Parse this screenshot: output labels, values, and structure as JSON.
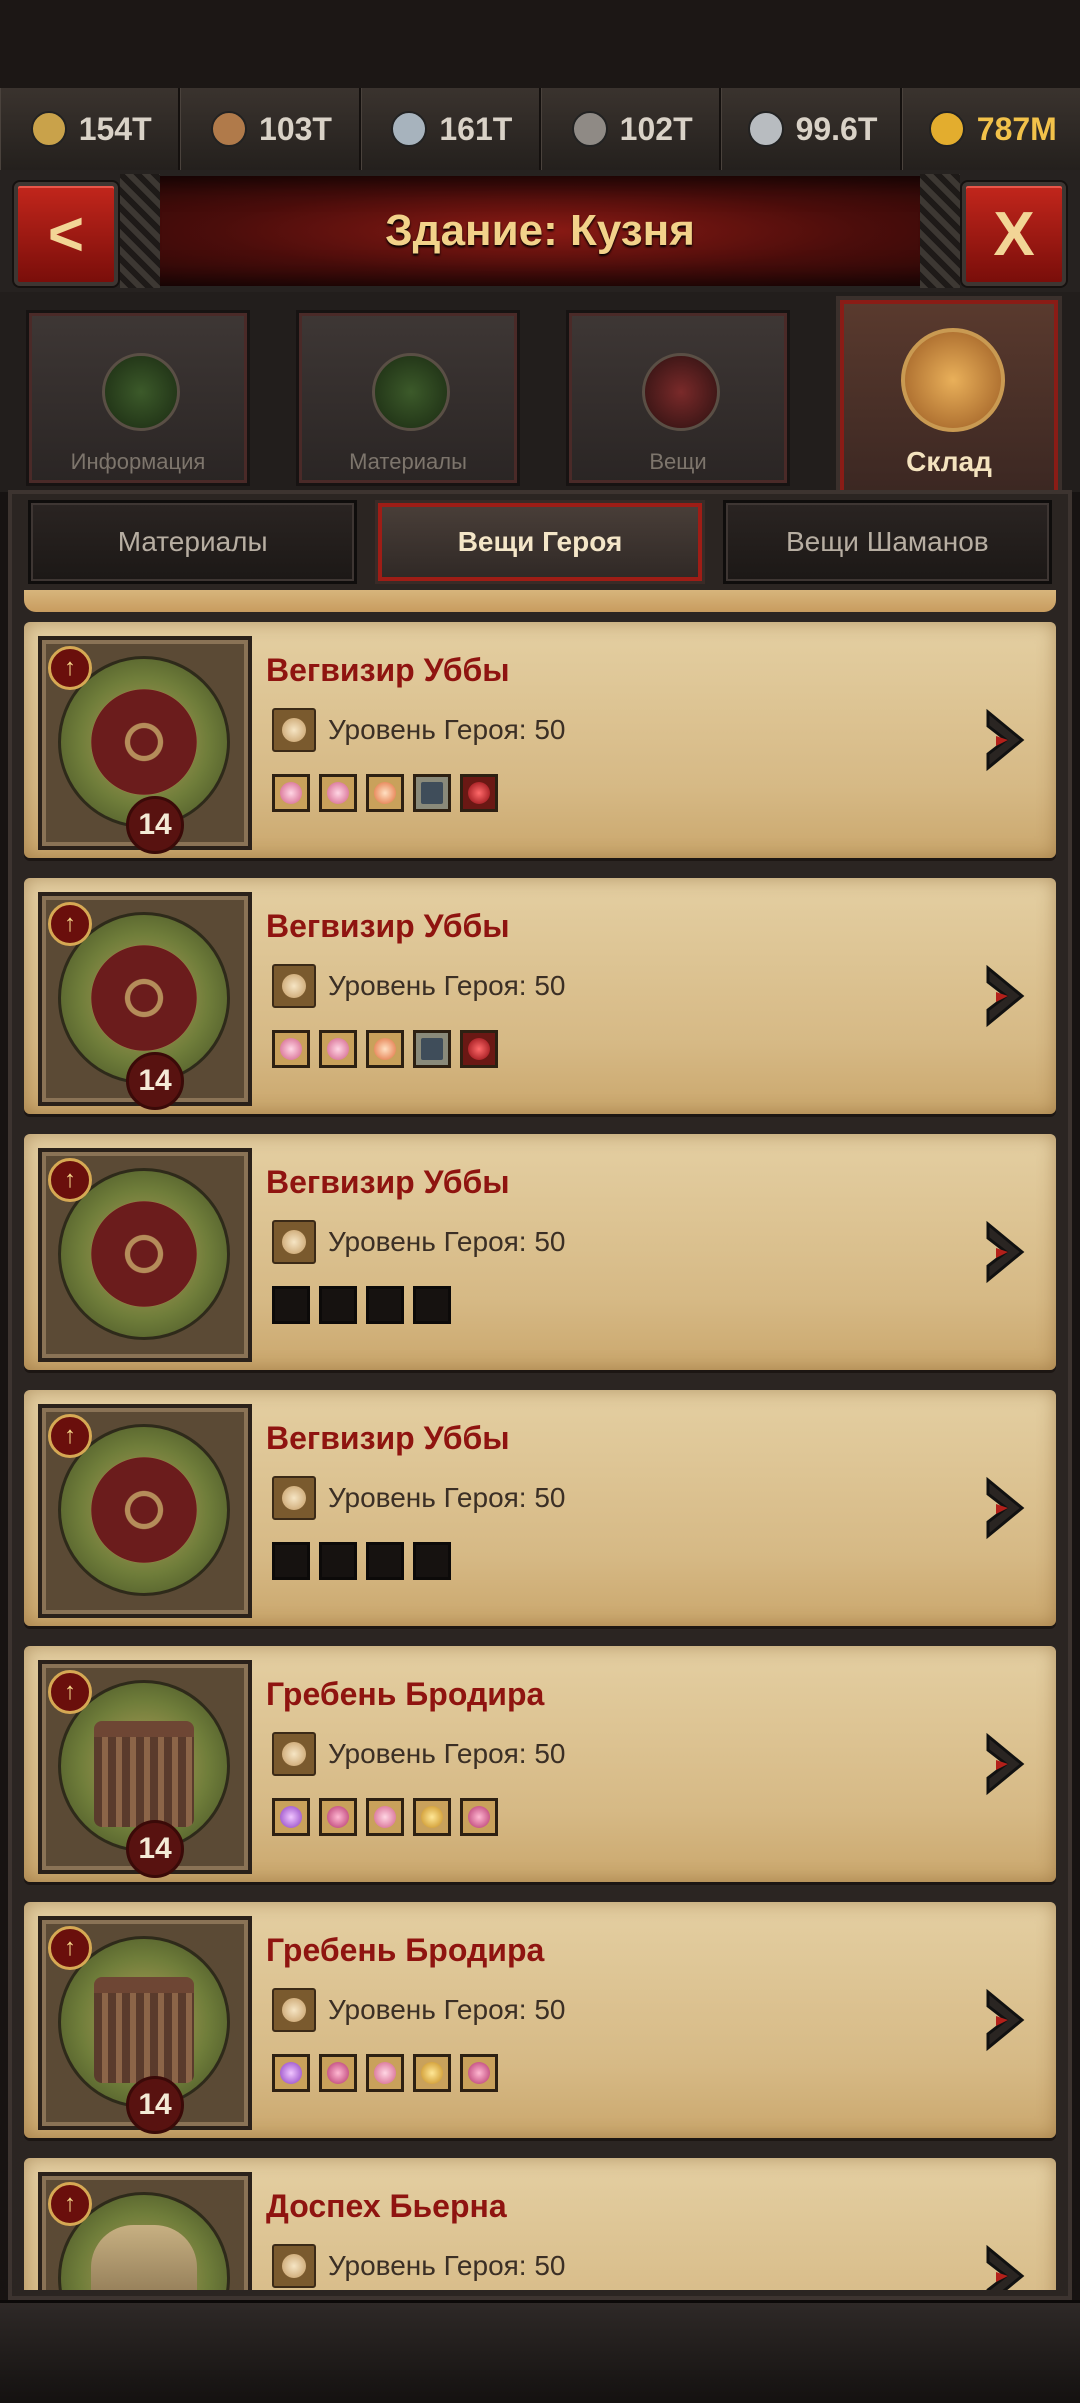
{
  "resources": [
    {
      "icon": "wheat-icon",
      "value": "154T"
    },
    {
      "icon": "wood-icon",
      "value": "103T"
    },
    {
      "icon": "iron-icon",
      "value": "161T"
    },
    {
      "icon": "stone-icon",
      "value": "102T"
    },
    {
      "icon": "silver-icon",
      "value": "99.6T"
    },
    {
      "icon": "gold-coin-icon",
      "value": "787M"
    }
  ],
  "header": {
    "title": "Здание: Кузня",
    "back_label": "<",
    "close_label": "X"
  },
  "building_tabs": [
    {
      "label": "Информация",
      "icon": "info-icon",
      "active": false
    },
    {
      "label": "Материалы",
      "icon": "materials-icon",
      "active": false
    },
    {
      "label": "Вещи",
      "icon": "items-icon",
      "active": false
    },
    {
      "label": "Склад",
      "icon": "warehouse-icon",
      "active": true
    }
  ],
  "sub_tabs": [
    {
      "label": "Материалы",
      "active": false
    },
    {
      "label": "Вещи Героя",
      "active": true
    },
    {
      "label": "Вещи Шаманов",
      "active": false
    }
  ],
  "items": [
    {
      "name": "Вегвизир Уббы",
      "requirement": "Уровень Героя: 50",
      "level": "14",
      "art": "vegvisir",
      "gems": [
        "pink",
        "pink",
        "orange",
        "rune",
        "red"
      ]
    },
    {
      "name": "Вегвизир Уббы",
      "requirement": "Уровень Героя: 50",
      "level": "14",
      "art": "vegvisir",
      "gems": [
        "pink",
        "pink",
        "orange",
        "rune",
        "red"
      ]
    },
    {
      "name": "Вегвизир Уббы",
      "requirement": "Уровень Героя: 50",
      "level": "",
      "art": "vegvisir",
      "gems": [
        "empty",
        "empty",
        "empty",
        "empty"
      ]
    },
    {
      "name": "Вегвизир Уббы",
      "requirement": "Уровень Героя: 50",
      "level": "",
      "art": "vegvisir",
      "gems": [
        "empty",
        "empty",
        "empty",
        "empty"
      ]
    },
    {
      "name": "Гребень Бродира",
      "requirement": "Уровень Героя: 50",
      "level": "14",
      "art": "comb",
      "gems": [
        "purple",
        "magenta",
        "pink",
        "coin",
        "magenta"
      ]
    },
    {
      "name": "Гребень Бродира",
      "requirement": "Уровень Героя: 50",
      "level": "14",
      "art": "comb",
      "gems": [
        "purple",
        "magenta",
        "pink",
        "coin",
        "magenta"
      ]
    },
    {
      "name": "Доспех Бьерна",
      "requirement": "Уровень Героя: 50",
      "level": "",
      "art": "armor",
      "gems": []
    }
  ],
  "colors": {
    "accent_red": "#8f1410",
    "gold": "#f2c24a",
    "parchment": "#e4cfa2"
  }
}
